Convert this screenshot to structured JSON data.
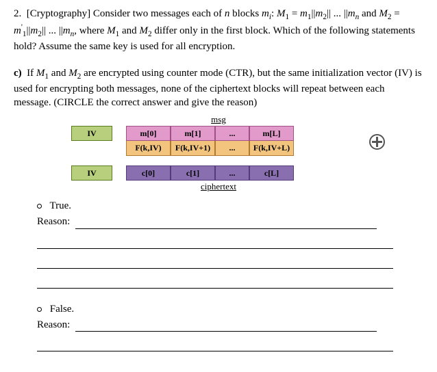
{
  "q_num": "2.",
  "q_tag": "[Cryptography]",
  "q_text_1": "Consider two messages each of ",
  "q_n": "n",
  "q_text_2": " blocks ",
  "q_mi": "m",
  "q_i": "i",
  "q_colon": ": ",
  "q_M1": "M",
  "q_1": "1",
  "q_eq": " = ",
  "q_m1": "m",
  "q_s1": "1",
  "q_bar": "||",
  "q_m2": "m",
  "q_s2": "2",
  "q_dots": " ... ",
  "q_mn": "m",
  "q_sn": "n",
  "q_and": " and ",
  "q_M2": "M",
  "q_2": "2",
  "q_mp1": "m",
  "q_p": "'",
  "q_ps1": "1",
  "q_tail": ", where ",
  "q_M1b": "M",
  "q_1b": "1",
  "q_and2": " and ",
  "q_M2b": "M",
  "q_2b": "2",
  "q_tail2": " differ only in the first block. Which of the following statements hold? Assume the same key is used for all encryption.",
  "c_label": "c)",
  "c_text_1": "If ",
  "c_M1": "M",
  "c_1": "1",
  "c_and": " and ",
  "c_M2": "M",
  "c_2": "2",
  "c_text_2": " are encrypted using counter mode (CTR), but the same initialization vector (IV) is used for encrypting both messages, none of the ciphertext blocks will repeat between each message. (CIRCLE the correct answer and give the reason)",
  "msg_label": "msg",
  "cipher_label": "ciphertext",
  "iv": "IV",
  "m0": "m[0]",
  "m1": "m[1]",
  "mdots": "...",
  "mL": "m[L]",
  "f0": "F(k,IV)",
  "f1": "F(k,IV+1)",
  "fdots": "...",
  "fL": "F(k,IV+L)",
  "c0": "c[0]",
  "c1": "c[1]",
  "cdots": "...",
  "cL": "c[L]",
  "true_label": "True.",
  "false_label": "False.",
  "reason_label": "Reason:"
}
